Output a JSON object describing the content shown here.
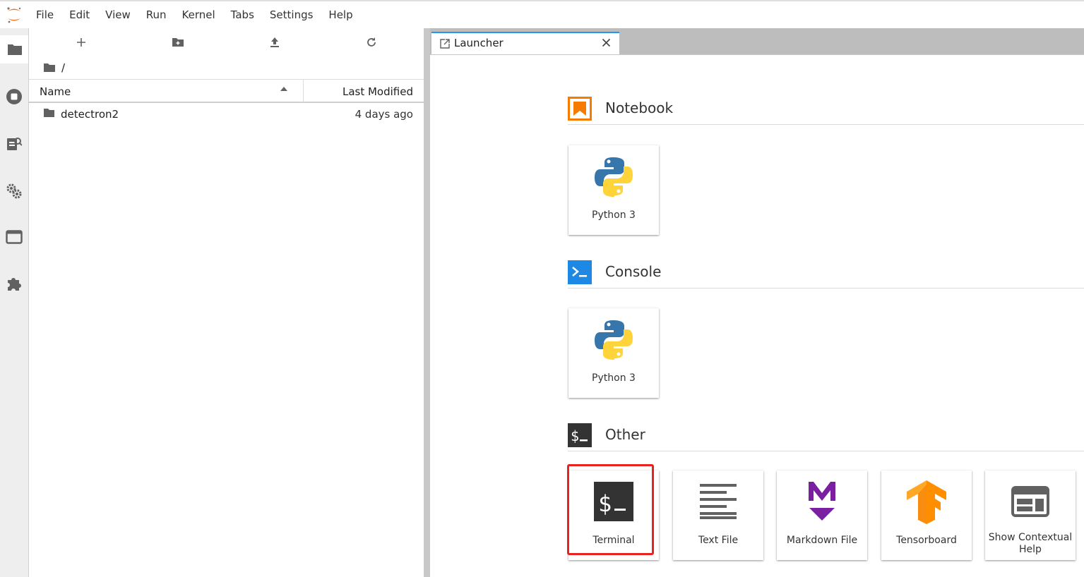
{
  "menubar": {
    "logo": "jupyter-logo-icon",
    "items": [
      "File",
      "Edit",
      "View",
      "Run",
      "Kernel",
      "Tabs",
      "Settings",
      "Help"
    ]
  },
  "activitybar": {
    "icons": [
      "folder-icon",
      "running-stop-icon",
      "property-inspector-icon",
      "settings-gears-icon",
      "tabs-window-icon",
      "extension-puzzle-icon"
    ]
  },
  "filebrowser": {
    "toolbar": [
      "new-launcher-icon",
      "new-folder-icon",
      "upload-icon",
      "refresh-icon"
    ],
    "breadcrumb": "/",
    "columns": {
      "name": "Name",
      "modified": "Last Modified"
    },
    "rows": [
      {
        "name": "detectron2",
        "modified": "4 days ago",
        "icon": "folder-icon"
      }
    ]
  },
  "tabs": [
    {
      "label": "Launcher",
      "icon": "launcher-tab-icon"
    }
  ],
  "launcher": {
    "sections": [
      {
        "title": "Notebook",
        "icon": "notebook-icon",
        "cards": [
          {
            "label": "Python 3",
            "icon": "python-logo-icon"
          }
        ]
      },
      {
        "title": "Console",
        "icon": "console-icon",
        "cards": [
          {
            "label": "Python 3",
            "icon": "python-logo-icon"
          }
        ]
      },
      {
        "title": "Other",
        "icon": "terminal-dollar-icon",
        "cards": [
          {
            "label": "Terminal",
            "icon": "terminal-icon"
          },
          {
            "label": "Text File",
            "icon": "text-file-icon"
          },
          {
            "label": "Markdown File",
            "icon": "markdown-icon"
          },
          {
            "label": "Tensorboard",
            "icon": "tensorflow-icon"
          },
          {
            "label": "Show Contextual Help",
            "label_lines": [
              "Show Contextual",
              "Help"
            ],
            "icon": "contextual-help-icon"
          }
        ]
      }
    ]
  },
  "colors": {
    "accent": "#2196f3",
    "notebook_orange": "#f57c00",
    "markdown_purple": "#7b1fa2",
    "highlight_red": "#e8231f",
    "python_blue": "#3776ab",
    "python_yellow": "#ffd43b"
  }
}
